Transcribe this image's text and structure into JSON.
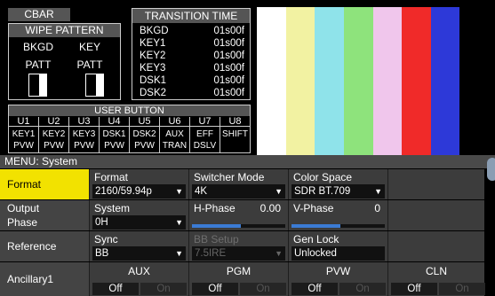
{
  "cbar": "CBAR",
  "wipe": {
    "title": "WIPE PATTERN",
    "bkgd": "BKGD",
    "key": "KEY",
    "patt1": "PATT",
    "patt2": "PATT"
  },
  "transition": {
    "title": "TRANSITION TIME",
    "rows": [
      {
        "name": "BKGD",
        "time": "01s00f"
      },
      {
        "name": "KEY1",
        "time": "01s00f"
      },
      {
        "name": "KEY2",
        "time": "01s00f"
      },
      {
        "name": "KEY3",
        "time": "01s00f"
      },
      {
        "name": "DSK1",
        "time": "01s00f"
      },
      {
        "name": "DSK2",
        "time": "01s00f"
      }
    ]
  },
  "user_button": {
    "title": "USER BUTTON",
    "buttons": [
      {
        "id": "U1",
        "l1": "KEY1",
        "l2": "PVW"
      },
      {
        "id": "U2",
        "l1": "KEY2",
        "l2": "PVW"
      },
      {
        "id": "U3",
        "l1": "KEY3",
        "l2": "PVW"
      },
      {
        "id": "U4",
        "l1": "DSK1",
        "l2": "PVW"
      },
      {
        "id": "U5",
        "l1": "DSK2",
        "l2": "PVW"
      },
      {
        "id": "U6",
        "l1": "AUX",
        "l2": "TRAN"
      },
      {
        "id": "U7",
        "l1": "EFF",
        "l2": "DSLV"
      },
      {
        "id": "U8",
        "l1": "SHIFT",
        "l2": ""
      }
    ]
  },
  "preview_colors": [
    "#ffffff",
    "#f2f2a2",
    "#8fe3ea",
    "#8ee37c",
    "#f0c6ec",
    "#f02a29",
    "#2d39d8",
    "#000000"
  ],
  "menu": {
    "title": "MENU: System",
    "format_row": {
      "label": "Format",
      "format_title": "Format",
      "format_value": "2160/59.94p",
      "switcher_title": "Switcher Mode",
      "switcher_value": "4K",
      "color_title": "Color Space",
      "color_value": "SDR BT.709"
    },
    "phase_row": {
      "label1": "Output",
      "label2": "Phase",
      "system_title": "System",
      "system_value": "0H",
      "hphase_title": "H-Phase",
      "hphase_value": "0.00",
      "vphase_title": "V-Phase",
      "vphase_value": "0"
    },
    "ref_row": {
      "label": "Reference",
      "sync_title": "Sync",
      "sync_value": "BB",
      "bb_title": "BB Setup",
      "bb_value": "7.5IRE",
      "genlock_title": "Gen Lock",
      "genlock_value": "Unlocked"
    },
    "anc_row": {
      "label": "Ancillary1",
      "groups": [
        {
          "title": "AUX",
          "off": "Off",
          "on": "On"
        },
        {
          "title": "PGM",
          "off": "Off",
          "on": "On"
        },
        {
          "title": "PVW",
          "off": "Off",
          "on": "On"
        },
        {
          "title": "CLN",
          "off": "Off",
          "on": "On"
        }
      ]
    }
  }
}
